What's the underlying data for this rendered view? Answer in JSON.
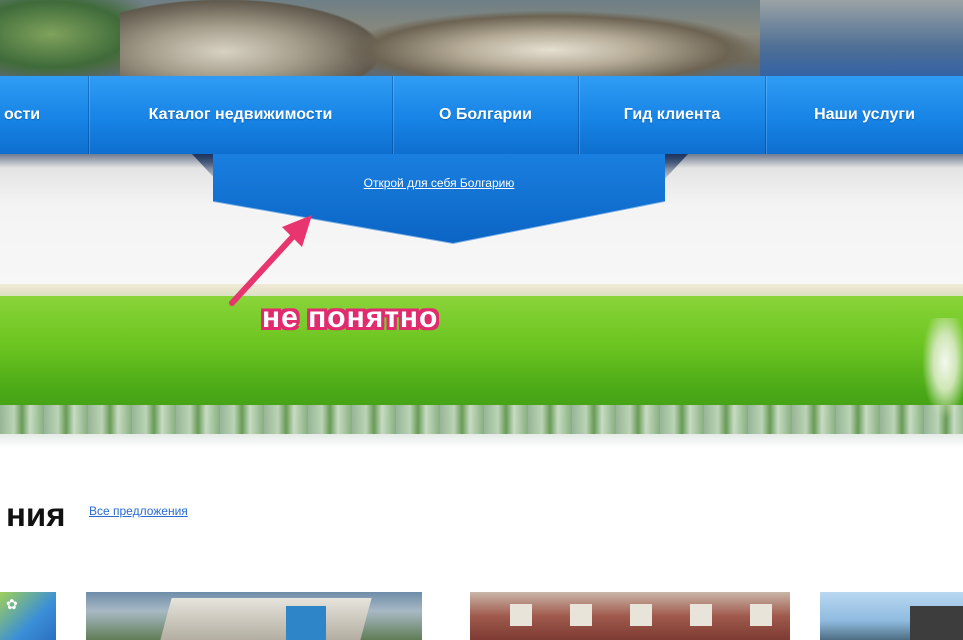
{
  "nav": {
    "items": [
      {
        "label": "ости"
      },
      {
        "label": "Каталог недвижимости"
      },
      {
        "label": "О Болгарии"
      },
      {
        "label": "Гид клиента"
      },
      {
        "label": "Наши услуги"
      }
    ]
  },
  "dropdown_tab": {
    "link_text": "Открой для себя Болгарию"
  },
  "annotation": {
    "text": "не понятно",
    "color": "#e02c6e"
  },
  "offers": {
    "heading": "ния",
    "all_link": "Все предложения"
  },
  "colors": {
    "nav_blue": "#1784e6",
    "banner_green": "#6cc520",
    "link_blue": "#2a6bd1"
  }
}
